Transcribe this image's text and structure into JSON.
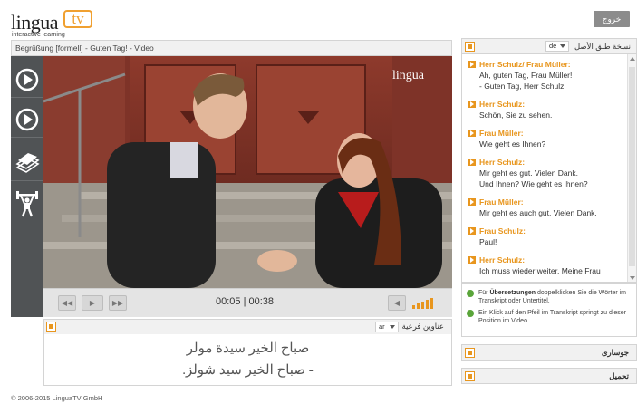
{
  "app": {
    "logo_text": "lingua",
    "logo_tv": "tv",
    "logo_tagline": "interactive learning",
    "exit_label": "خروج"
  },
  "video": {
    "title": "Begrüßung [formell] - Guten Tag! - Video",
    "watermark": "lingua",
    "time_current": "00:05",
    "time_separator": "|",
    "time_total": "00:38",
    "volume_level": 1.0
  },
  "side_tools": [
    {
      "icon": "play-circle-icon"
    },
    {
      "icon": "play-circle-icon"
    },
    {
      "icon": "flashcards-icon"
    },
    {
      "icon": "weightlifter-icon"
    }
  ],
  "subtitles": {
    "header": "عناوين فرعية",
    "lang": "ar",
    "lines": [
      "صباح الخير سيدة مولر",
      "- صباح الخير سيد شولز."
    ]
  },
  "transcript": {
    "header": "نسخة طبق الأصل",
    "lang": "de",
    "entries": [
      {
        "speaker": "Herr Schulz/ Frau Müller:",
        "lines": [
          "Ah, guten Tag, Frau Müller!",
          "- Guten Tag, Herr Schulz!"
        ]
      },
      {
        "speaker": "Herr Schulz:",
        "lines": [
          "Schön, Sie zu sehen."
        ]
      },
      {
        "speaker": "Frau Müller:",
        "lines": [
          "Wie geht es Ihnen?"
        ]
      },
      {
        "speaker": "Herr Schulz:",
        "lines": [
          "Mir geht es gut. Vielen Dank.",
          "Und Ihnen? Wie geht es Ihnen?"
        ]
      },
      {
        "speaker": "Frau Müller:",
        "lines": [
          "Mir geht es auch gut. Vielen Dank."
        ]
      },
      {
        "speaker": "Frau Schulz:",
        "lines": [
          "Paul!"
        ]
      },
      {
        "speaker": "Herr Schulz:",
        "lines": [
          "Ich muss wieder weiter. Meine Frau"
        ]
      }
    ]
  },
  "hints": [
    {
      "before": "Für ",
      "bold": "Übersetzungen",
      "after": " doppelklicken Sie die Wörter im Transkript oder Untertitel."
    },
    {
      "before": "Ein Klick auf den Pfeil im Transkript springt zu dieser Position im Video.",
      "bold": "",
      "after": ""
    }
  ],
  "panels": {
    "vocabulary": "جوسارى",
    "download": "تحميل"
  },
  "footer": {
    "copyright": "© 2006-2015 LinguaTV GmbH"
  },
  "colors": {
    "accent": "#e8961e",
    "toolbar": "#505355",
    "hint_green": "#5aa53a"
  }
}
